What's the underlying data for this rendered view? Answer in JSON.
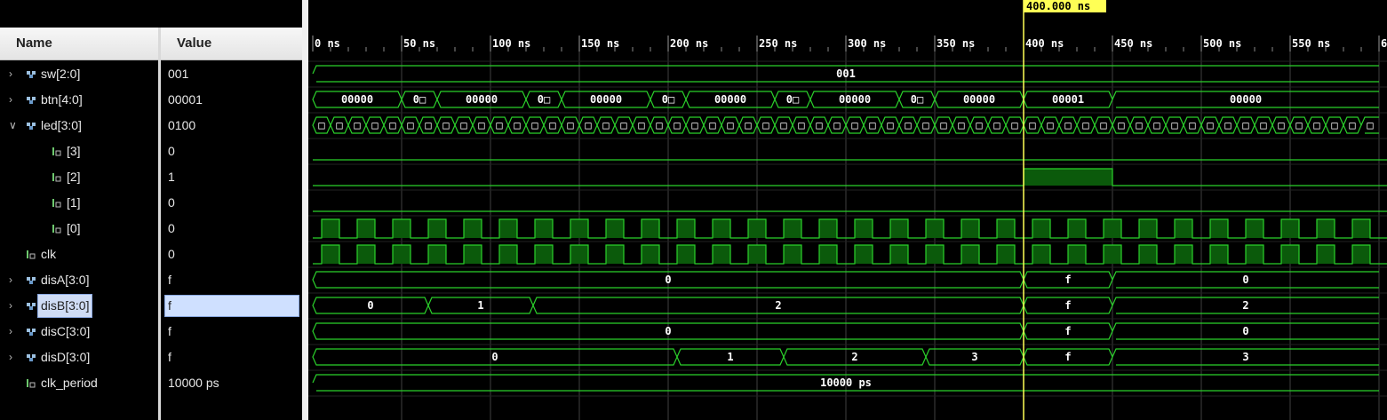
{
  "header": {
    "name": "Name",
    "value": "Value"
  },
  "signals": [
    {
      "name": "sw[2:0]",
      "value": "001",
      "expand": "collapsed",
      "icon": "bus-icon",
      "indent": 0
    },
    {
      "name": "btn[4:0]",
      "value": "00001",
      "expand": "collapsed",
      "icon": "bus-icon",
      "indent": 0
    },
    {
      "name": "led[3:0]",
      "value": "0100",
      "expand": "expanded",
      "icon": "bus-icon",
      "indent": 0
    },
    {
      "name": "[3]",
      "value": "0",
      "expand": "none",
      "icon": "bit-icon",
      "indent": 1
    },
    {
      "name": "[2]",
      "value": "1",
      "expand": "none",
      "icon": "bit-icon",
      "indent": 1
    },
    {
      "name": "[1]",
      "value": "0",
      "expand": "none",
      "icon": "bit-icon",
      "indent": 1
    },
    {
      "name": "[0]",
      "value": "0",
      "expand": "none",
      "icon": "bit-icon",
      "indent": 1
    },
    {
      "name": "clk",
      "value": "0",
      "expand": "none",
      "icon": "bit-icon",
      "indent": 0
    },
    {
      "name": "disA[3:0]",
      "value": "f",
      "expand": "collapsed",
      "icon": "bus-icon",
      "indent": 0
    },
    {
      "name": "disB[3:0]",
      "value": "f",
      "expand": "collapsed",
      "icon": "bus-icon",
      "indent": 0,
      "selected": true
    },
    {
      "name": "disC[3:0]",
      "value": "f",
      "expand": "collapsed",
      "icon": "bus-icon",
      "indent": 0
    },
    {
      "name": "disD[3:0]",
      "value": "f",
      "expand": "collapsed",
      "icon": "bus-icon",
      "indent": 0
    },
    {
      "name": "clk_period",
      "value": "10000 ps",
      "expand": "none",
      "icon": "bit-icon",
      "indent": 0
    }
  ],
  "timeline": {
    "range_ns": [
      0,
      600
    ],
    "ticks": [
      "0 ns",
      "50 ns",
      "100 ns",
      "150 ns",
      "200 ns",
      "250 ns",
      "300 ns",
      "350 ns",
      "400 ns",
      "450 ns",
      "500 ns",
      "550 ns",
      "6"
    ],
    "cursor_ns": 400,
    "cursor_label": "400.000 ns"
  },
  "waves": {
    "sw": [
      {
        "s": 0,
        "e": 600,
        "v": "001"
      }
    ],
    "btn": [
      {
        "s": 0,
        "e": 50,
        "v": "00000"
      },
      {
        "s": 50,
        "e": 70,
        "v": "0□"
      },
      {
        "s": 70,
        "e": 120,
        "v": "00000"
      },
      {
        "s": 120,
        "e": 140,
        "v": "0□"
      },
      {
        "s": 140,
        "e": 190,
        "v": "00000"
      },
      {
        "s": 190,
        "e": 210,
        "v": "0□"
      },
      {
        "s": 210,
        "e": 260,
        "v": "00000"
      },
      {
        "s": 260,
        "e": 280,
        "v": "0□"
      },
      {
        "s": 280,
        "e": 330,
        "v": "00000"
      },
      {
        "s": 330,
        "e": 350,
        "v": "0□"
      },
      {
        "s": 350,
        "e": 400,
        "v": "00000"
      },
      {
        "s": 400,
        "e": 450,
        "v": "00001"
      },
      {
        "s": 450,
        "e": 600,
        "v": "00000"
      }
    ],
    "led_bus": {
      "period_ns": 10,
      "cell_label": "□"
    },
    "led2_high": [
      400,
      450
    ],
    "clk_period_ns": 20,
    "clk_high_offset_ns": 5,
    "disA": [
      {
        "s": 0,
        "e": 400,
        "v": "0"
      },
      {
        "s": 400,
        "e": 450,
        "v": "f"
      },
      {
        "s": 450,
        "e": 600,
        "v": "0"
      }
    ],
    "disB": [
      {
        "s": 0,
        "e": 65,
        "v": "0"
      },
      {
        "s": 65,
        "e": 124,
        "v": "1"
      },
      {
        "s": 124,
        "e": 400,
        "v": "2"
      },
      {
        "s": 400,
        "e": 450,
        "v": "f"
      },
      {
        "s": 450,
        "e": 600,
        "v": "2"
      }
    ],
    "disC": [
      {
        "s": 0,
        "e": 400,
        "v": "0"
      },
      {
        "s": 400,
        "e": 450,
        "v": "f"
      },
      {
        "s": 450,
        "e": 600,
        "v": "0"
      }
    ],
    "disD": [
      {
        "s": 0,
        "e": 205,
        "v": "0"
      },
      {
        "s": 205,
        "e": 265,
        "v": "1"
      },
      {
        "s": 265,
        "e": 345,
        "v": "2"
      },
      {
        "s": 345,
        "e": 400,
        "v": "3"
      },
      {
        "s": 400,
        "e": 450,
        "v": "f"
      },
      {
        "s": 450,
        "e": 600,
        "v": "3"
      }
    ],
    "clk_period": [
      {
        "s": 0,
        "e": 600,
        "v": "10000 ps"
      }
    ]
  },
  "colors": {
    "wave": "#2bd12b",
    "fill": "#0b5a0b",
    "cursor": "#ffff55",
    "grid": "#404040",
    "text": "#ffffff"
  }
}
